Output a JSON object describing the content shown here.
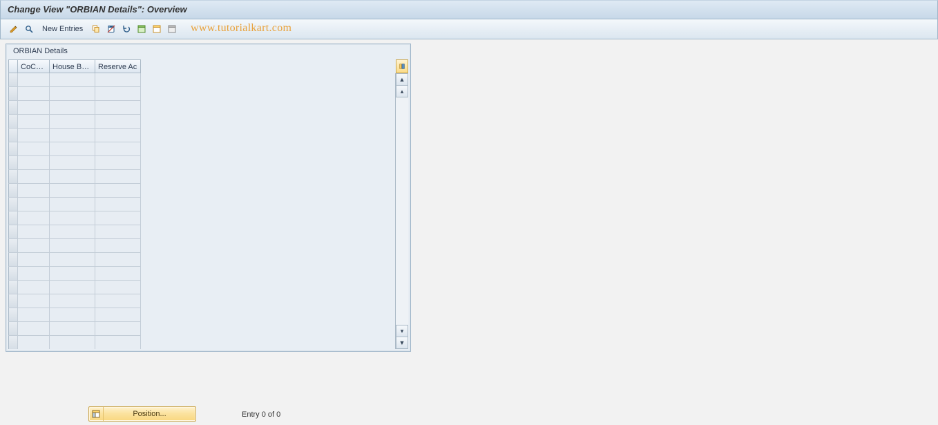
{
  "title": "Change View \"ORBIAN Details\": Overview",
  "toolbar": {
    "new_entries_label": "New Entries"
  },
  "watermark": "www.tutorialkart.com",
  "table": {
    "caption": "ORBIAN Details",
    "columns": {
      "cocode": "CoCode",
      "house_bank": "House Ba...",
      "reserve_ac": "Reserve Ac"
    },
    "row_count": 20
  },
  "footer": {
    "position_label": "Position...",
    "entry_status": "Entry 0 of 0"
  }
}
